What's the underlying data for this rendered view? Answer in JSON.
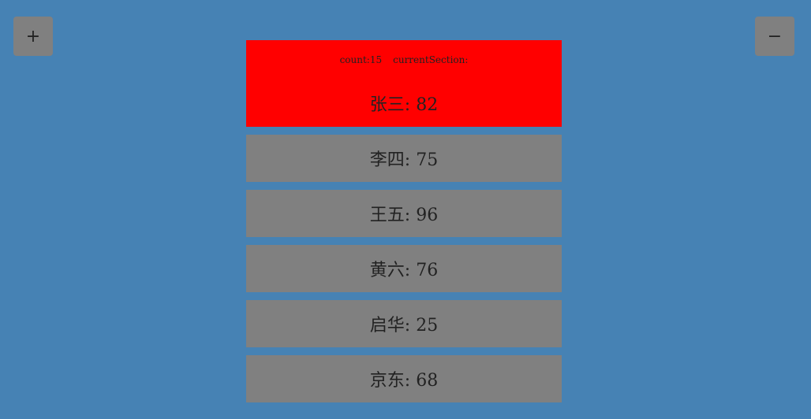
{
  "controls": {
    "add_label": "+",
    "remove_label": "−"
  },
  "header": {
    "count_text": "count:15",
    "section_text": "currentSection:"
  },
  "rows": [
    {
      "name": "张三",
      "sep": ": ",
      "score": "82"
    },
    {
      "name": "李四",
      "sep": ": ",
      "score": "75"
    },
    {
      "name": "王五",
      "sep": ": ",
      "score": "96"
    },
    {
      "name": "黄六",
      "sep": ": ",
      "score": "76"
    },
    {
      "name": "启华",
      "sep": ": ",
      "score": "25"
    },
    {
      "name": "京东",
      "sep": ": ",
      "score": "68"
    }
  ],
  "colors": {
    "background": "#4682b4",
    "highlight": "#ff0000",
    "row": "#808080"
  }
}
